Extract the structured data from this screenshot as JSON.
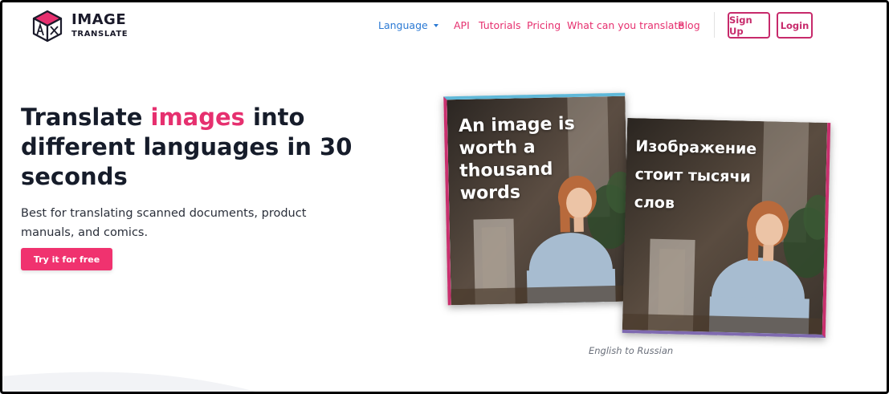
{
  "brand": {
    "name_line1": "IMAGE",
    "name_line2": "TRANSLATE"
  },
  "nav": {
    "language_label": "Language",
    "links": [
      "API",
      "Tutorials",
      "Pricing",
      "What can you translate",
      "Blog"
    ],
    "signup_label": "Sign Up",
    "login_label": "Login"
  },
  "hero": {
    "title_part1": "Translate ",
    "title_highlight": "images",
    "title_part2": " into different languages in 30 seconds",
    "subtitle": "Best for translating scanned documents, product manuals, and comics.",
    "cta_label": "Try it for free"
  },
  "demo": {
    "source_text": "An image is\nworth a\nthousand\nwords",
    "translated_text": "Изображение\nстоит тысячи\nслов",
    "caption": "English to Russian"
  },
  "colors": {
    "accent": "#e6306f",
    "language_link": "#2a79d4",
    "cta_bg": "#f0326f",
    "outline_button": "#c72a6b"
  }
}
